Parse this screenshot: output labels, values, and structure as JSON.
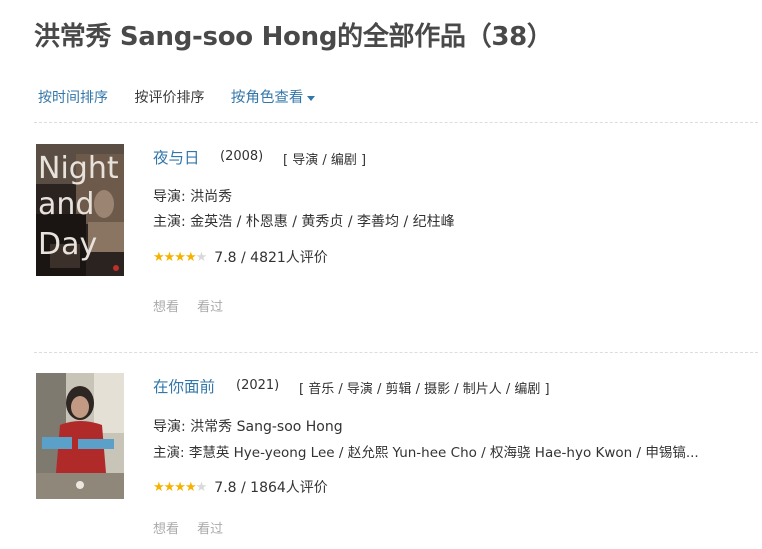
{
  "page": {
    "title": "洪常秀 Sang-soo Hong的全部作品（38）"
  },
  "sort": {
    "by_time": "按时间排序",
    "by_rating": "按评价排序",
    "by_role": "按角色查看"
  },
  "movies": [
    {
      "title": "夜与日",
      "year": "(2008)",
      "roles": "[ 导演 / 编剧 ]",
      "poster_text": [
        "Night",
        "and",
        "Day"
      ],
      "director": "导演: 洪尚秀",
      "cast": "主演: 金英浩 / 朴恩惠 / 黄秀贞 / 李善均 / 纪柱峰",
      "stars": 4,
      "rating_text": "7.8 / 4821人评价",
      "want": "想看",
      "seen": "看过"
    },
    {
      "title": "在你面前",
      "year": "(2021)",
      "roles": "[ 音乐 / 导演 / 剪辑 / 摄影 / 制片人 / 编剧 ]",
      "director": "导演: 洪常秀 Sang-soo Hong",
      "cast": "主演: 李慧英 Hye-yeong Lee / 赵允熙 Yun-hee Cho / 权海骁 Hae-hyo Kwon / 申锡镐...",
      "stars": 4,
      "rating_text": "7.8 / 1864人评价",
      "want": "想看",
      "seen": "看过"
    }
  ],
  "colors": {
    "link": "#3377aa",
    "title": "#494949",
    "star": "#f5b300"
  }
}
